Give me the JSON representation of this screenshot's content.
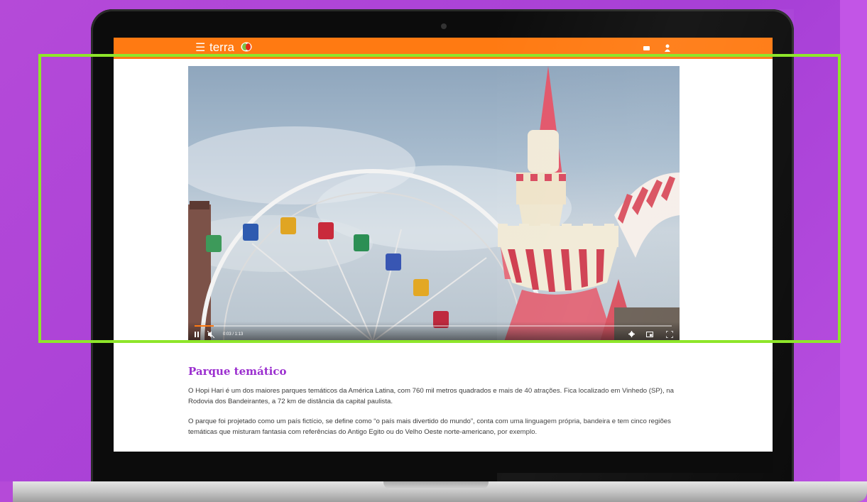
{
  "header": {
    "menu_icon": "☰",
    "logo_text": "terra",
    "icons": [
      "menu-icon",
      "terra-logo-icon",
      "mail-icon",
      "user-icon"
    ],
    "accent_color": "#ff7a12"
  },
  "video": {
    "time": "0:03 / 1:13",
    "progress": 0.04,
    "icons": [
      "pause-icon",
      "mute-icon",
      "settings-icon",
      "pip-icon",
      "fullscreen-icon"
    ]
  },
  "article": {
    "title": "Parque temático",
    "title_color": "#9b2fcf",
    "paragraphs": [
      "O Hopi Hari é um dos maiores parques temáticos da América Latina, com 760 mil metros quadrados e mais de 40 atrações. Fica localizado em Vinhedo (SP), na Rodovia dos Bandeirantes, a 72 km de distância da capital paulista.",
      "O parque foi projetado como um país fictício, se define como “o país mais divertido do mundo”, conta com uma linguagem própria, bandeira e tem cinco regiões temáticas que misturam fantasia com referências do Antigo Egito ou do Velho Oeste norte-americano, por exemplo."
    ]
  },
  "highlight_color": "#8ee62a"
}
